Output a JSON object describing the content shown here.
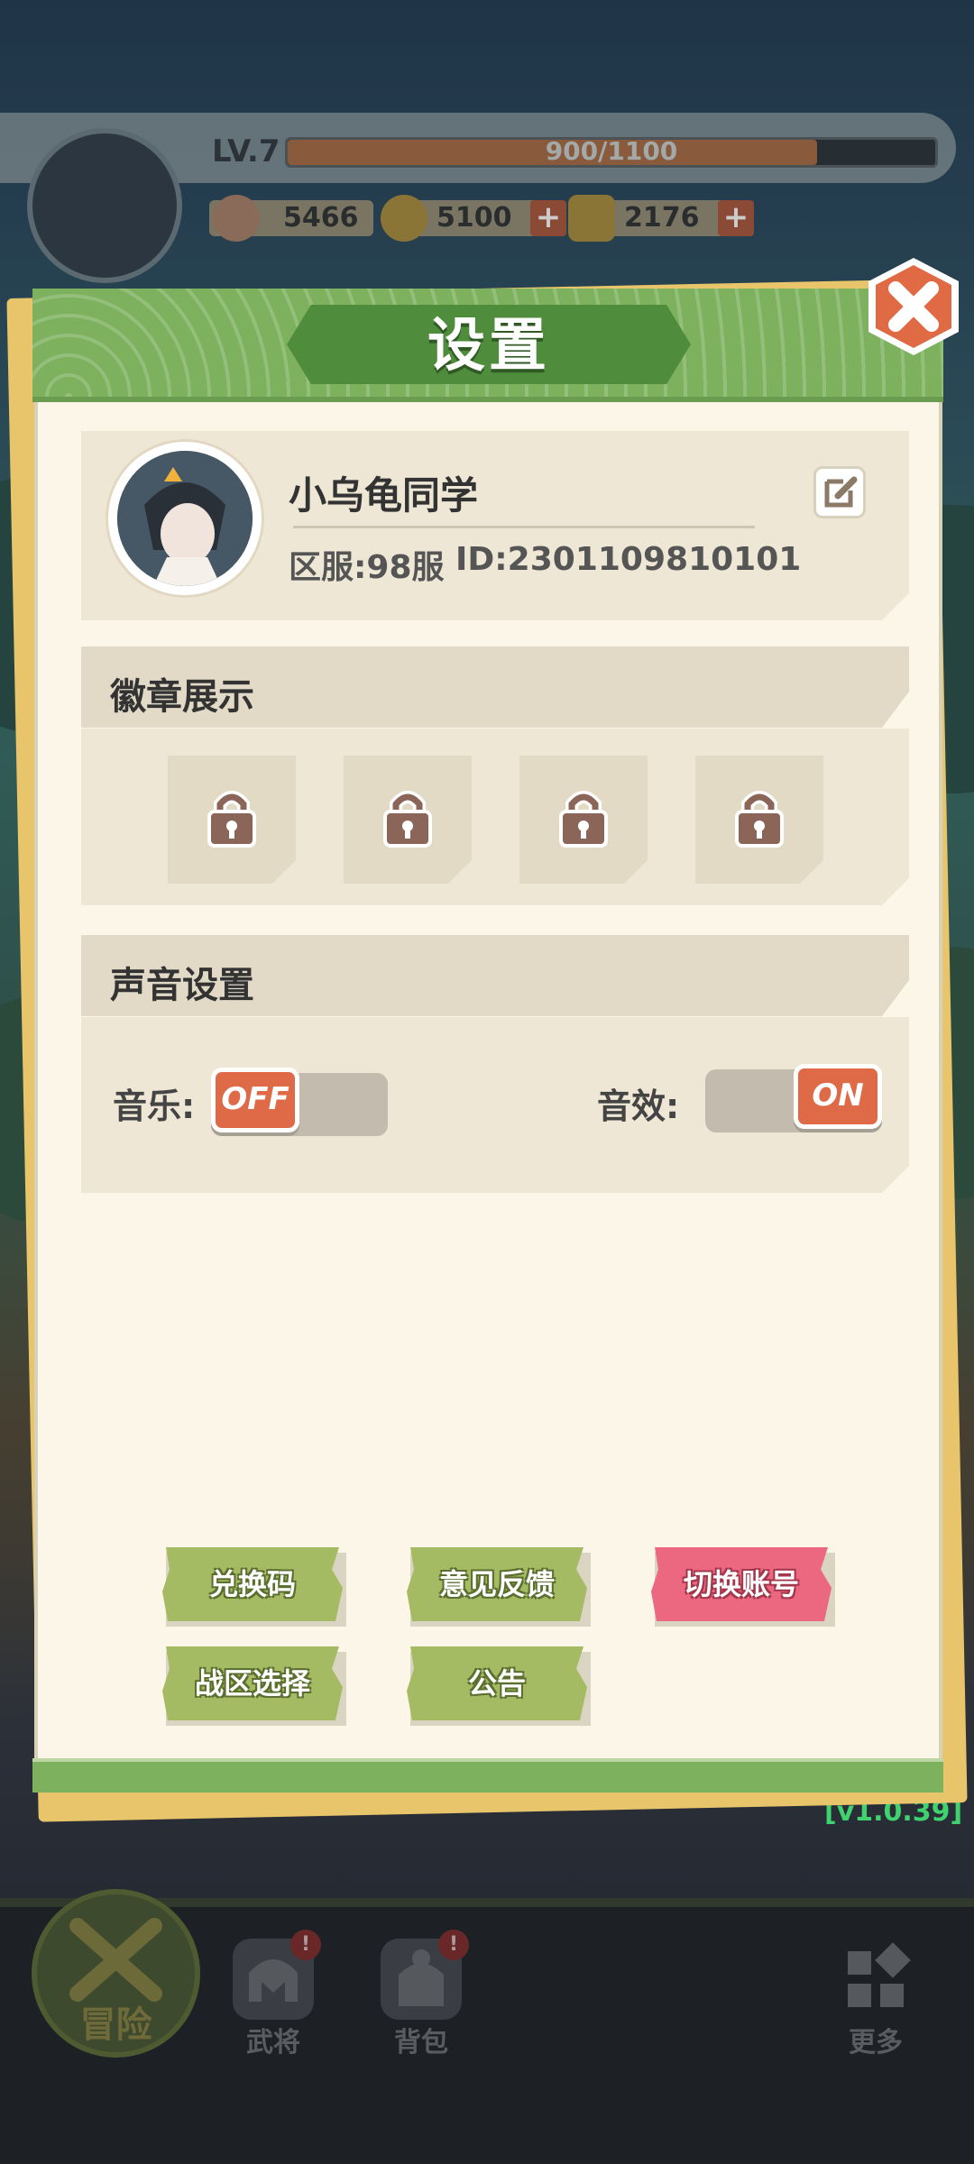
{
  "player_bar": {
    "level": "LV.7",
    "xp_text": "900/1100",
    "xp_current": 900,
    "xp_max": 1100,
    "power": "5466",
    "coins": "5100",
    "ingots": "2176",
    "plus_symbol": "+"
  },
  "modal": {
    "title": "设置",
    "profile": {
      "nickname": "小乌龟同学",
      "server": "区服:98服",
      "player_id": "ID:2301109810101"
    },
    "badges": {
      "title": "徽章展示",
      "slots": [
        "locked",
        "locked",
        "locked",
        "locked"
      ]
    },
    "sound": {
      "title": "声音设置",
      "music_label": "音乐:",
      "music_state": "OFF",
      "sfx_label": "音效:",
      "sfx_state": "ON"
    },
    "buttons": {
      "redeem": "兑换码",
      "feedback": "意见反馈",
      "switch_account": "切换账号",
      "server_select": "战区选择",
      "announcement": "公告"
    }
  },
  "version": "[v1.0.39]",
  "nav": {
    "adventure": "冒险",
    "generals": "武将",
    "backpack": "背包",
    "more": "更多",
    "badge_mark": "!"
  },
  "colors": {
    "header_green": "#7db15e",
    "title_plate": "#4f8c3c",
    "toggle_orange": "#de6a47",
    "button_green": "#a5bb63",
    "button_pink": "#ec6780",
    "version_green": "#40d26e"
  }
}
